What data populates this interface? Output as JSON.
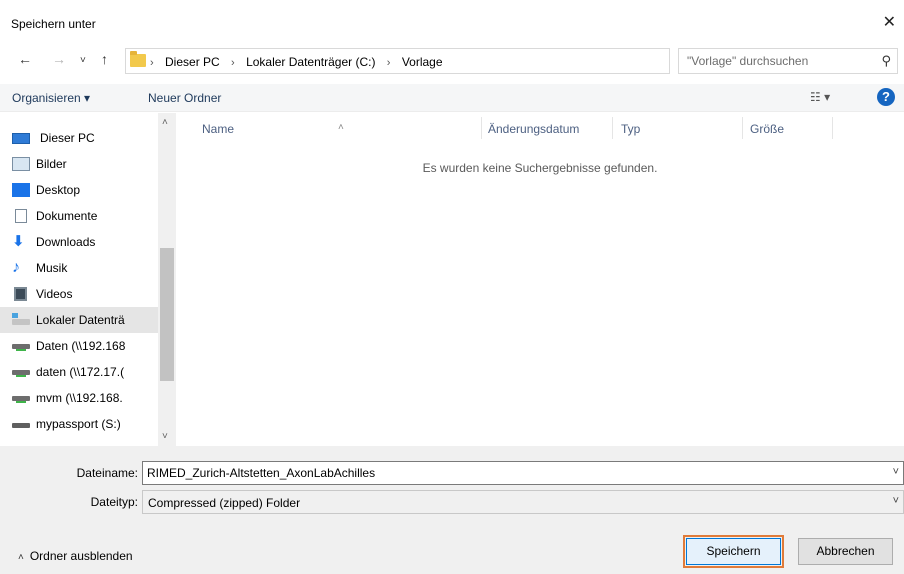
{
  "window": {
    "title": "Speichern unter"
  },
  "address": {
    "crumbs": [
      "Dieser PC",
      "Lokaler Datenträger (C:)",
      "Vorlage"
    ],
    "search_placeholder": "\"Vorlage\" durchsuchen"
  },
  "toolbar": {
    "organize": "Organisieren ▾",
    "new_folder": "Neuer Ordner"
  },
  "nav": {
    "items": [
      {
        "label": "Dieser PC",
        "icon": "pc-icon"
      },
      {
        "label": "Bilder",
        "icon": "pictures-icon"
      },
      {
        "label": "Desktop",
        "icon": "desktop-icon"
      },
      {
        "label": "Dokumente",
        "icon": "documents-icon"
      },
      {
        "label": "Downloads",
        "icon": "downloads-icon"
      },
      {
        "label": "Musik",
        "icon": "music-icon"
      },
      {
        "label": "Videos",
        "icon": "videos-icon"
      },
      {
        "label": "Lokaler Datenträ",
        "icon": "local-drive-icon",
        "selected": true
      },
      {
        "label": "Daten (\\\\192.168",
        "icon": "network-drive-icon"
      },
      {
        "label": "daten (\\\\172.17.(",
        "icon": "network-drive-icon"
      },
      {
        "label": "mvm (\\\\192.168.",
        "icon": "network-drive-icon"
      },
      {
        "label": "mypassport (S:)",
        "icon": "usb-drive-icon"
      }
    ]
  },
  "files": {
    "columns": [
      "Name",
      "Änderungsdatum",
      "Typ",
      "Größe"
    ],
    "empty_message": "Es wurden keine Suchergebnisse gefunden."
  },
  "form": {
    "filename_label": "Dateiname:",
    "filename_value": "RIMED_Zurich-Altstetten_AxonLabAchilles",
    "filetype_label": "Dateityp:",
    "filetype_value": "Compressed (zipped) Folder"
  },
  "footer": {
    "hide_folders": "Ordner ausblenden",
    "save": "Speichern",
    "cancel": "Abbrechen"
  }
}
